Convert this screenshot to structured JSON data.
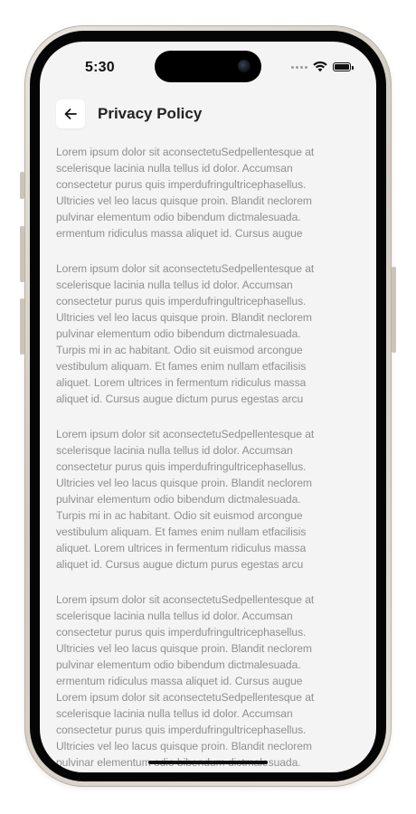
{
  "status_bar": {
    "time": "5:30",
    "icons": [
      "signal-dots-icon",
      "wifi-icon",
      "battery-icon"
    ]
  },
  "header": {
    "back_icon": "arrow-left-icon",
    "title": "Privacy Policy"
  },
  "paragraphs": [
    "Lorem ipsum dolor sit aconsectetuSedpellentesque at\nscelerisque lacinia nulla tellus id dolor. Accumsan\nconsectetur purus quis imperdufringultricephasellus.\nUltricies vel leo lacus quisque proin. Blandit neclorem\npulvinar elementum odio bibendum dictmalesuada.\nermentum ridiculus massa aliquet id. Cursus augue",
    "Lorem ipsum dolor sit aconsectetuSedpellentesque at\nscelerisque lacinia nulla tellus id dolor. Accumsan\nconsectetur purus quis imperdufringultricephasellus.\nUltricies vel leo lacus quisque proin. Blandit neclorem\npulvinar elementum odio bibendum dictmalesuada.\nTurpis mi in ac habitant. Odio sit euismod  arcongue\nvestibulum aliquam. Et fames enim nullam etfacilisis\naliquet. Lorem ultrices in fermentum ridiculus massa\naliquet id. Cursus augue dictum purus egestas arcu",
    "Lorem ipsum dolor sit aconsectetuSedpellentesque at\nscelerisque lacinia nulla tellus id dolor. Accumsan\nconsectetur purus quis imperdufringultricephasellus.\nUltricies vel leo lacus quisque proin. Blandit neclorem\npulvinar elementum odio bibendum dictmalesuada.\nTurpis mi in ac habitant. Odio sit euismod  arcongue\nvestibulum aliquam. Et fames enim nullam etfacilisis\naliquet. Lorem ultrices in fermentum ridiculus massa\naliquet id. Cursus augue dictum purus egestas arcu",
    "Lorem ipsum dolor sit aconsectetuSedpellentesque at\nscelerisque lacinia nulla tellus id dolor. Accumsan\nconsectetur purus quis imperdufringultricephasellus.\nUltricies vel leo lacus quisque proin. Blandit neclorem\npulvinar elementum odio bibendum dictmalesuada.\nermentum ridiculus massa aliquet id. Cursus augue\nLorem ipsum dolor sit aconsectetuSedpellentesque at\nscelerisque lacinia nulla tellus id dolor. Accumsan\nconsectetur purus quis imperdufringultricephasellus.\nUltricies vel leo lacus quisque proin. Blandit neclorem\npulvinar elementum odio bibendum dictmalesuada.\nermentum ridiculus massa aliquet id. Cursus augue"
  ],
  "colors": {
    "screen_background": "#f4f4f4",
    "body_text": "#8f8f8f",
    "title_text": "#222222"
  }
}
